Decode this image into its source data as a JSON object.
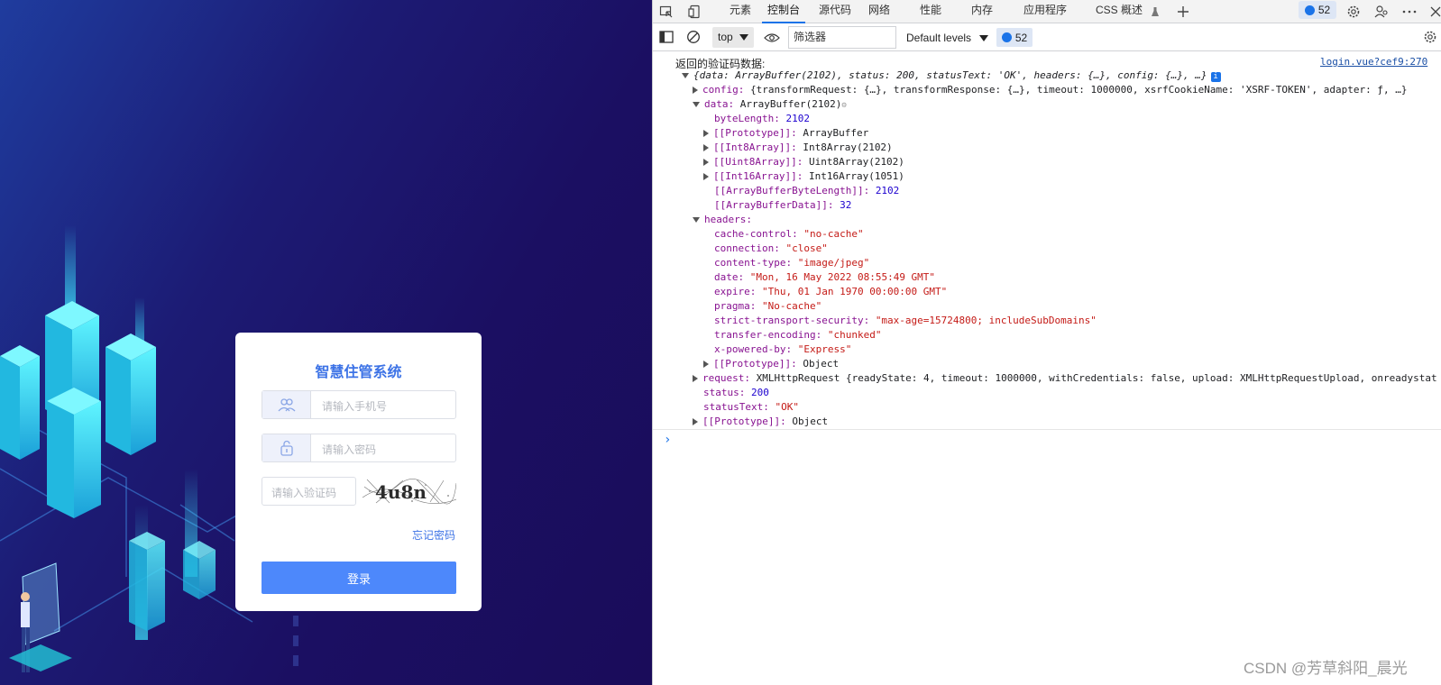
{
  "app": {
    "title": "智慧住管系统",
    "phone_placeholder": "请输入手机号",
    "password_placeholder": "请输入密码",
    "captcha_placeholder": "请输入验证码",
    "captcha_text": "4u8n",
    "forgot_label": "忘记密码",
    "login_label": "登录",
    "accent_color": "#4d88fb",
    "title_color": "#3d73e6"
  },
  "devtools": {
    "tabs": [
      "元素",
      "控制台",
      "源代码",
      "网络",
      "性能",
      "内存",
      "应用程序",
      "CSS 概述"
    ],
    "active_tab": "控制台",
    "message_count": "52",
    "context": "top",
    "filter_placeholder": "筛选器",
    "levels_label": "Default levels",
    "issues_count": "52",
    "log_label": "返回的验证码数据:",
    "source_link": "login.vue?cef9:270",
    "lines": {
      "root": "{data: ArrayBuffer(2102), status: 200, statusText: 'OK', headers: {…}, config: {…}, …}",
      "config_key": "config:",
      "config_val": "{transformRequest: {…}, transformResponse: {…}, timeout: 1000000, xsrfCookieName: 'XSRF-TOKEN', adapter: ƒ, …}",
      "data_key": "data:",
      "data_val": "ArrayBuffer(2102)",
      "byteLength_key": "byteLength:",
      "byteLength_val": "2102",
      "proto_ab_key": "[[Prototype]]:",
      "proto_ab_val": "ArrayBuffer",
      "int8_key": "[[Int8Array]]:",
      "int8_val": "Int8Array(2102)",
      "uint8_key": "[[Uint8Array]]:",
      "uint8_val": "Uint8Array(2102)",
      "int16_key": "[[Int16Array]]:",
      "int16_val": "Int16Array(1051)",
      "abbl_key": "[[ArrayBufferByteLength]]:",
      "abbl_val": "2102",
      "abd_key": "[[ArrayBufferData]]:",
      "abd_val": "32",
      "headers_key": "headers:",
      "cache_key": "cache-control:",
      "cache_val": "\"no-cache\"",
      "conn_key": "connection:",
      "conn_val": "\"close\"",
      "ctype_key": "content-type:",
      "ctype_val": "\"image/jpeg\"",
      "date_key": "date:",
      "date_val": "\"Mon, 16 May 2022 08:55:49 GMT\"",
      "expire_key": "expire:",
      "expire_val": "\"Thu, 01 Jan 1970 00:00:00 GMT\"",
      "pragma_key": "pragma:",
      "pragma_val": "\"No-cache\"",
      "sts_key": "strict-transport-security:",
      "sts_val": "\"max-age=15724800; includeSubDomains\"",
      "te_key": "transfer-encoding:",
      "te_val": "\"chunked\"",
      "xpb_key": "x-powered-by:",
      "xpb_val": "\"Express\"",
      "proto_obj_key": "[[Prototype]]:",
      "proto_obj_val": "Object",
      "request_key": "request:",
      "request_val": "XMLHttpRequest {readyState: 4, timeout: 1000000, withCredentials: false, upload: XMLHttpRequestUpload, onreadystat",
      "status_key": "status:",
      "status_val": "200",
      "statusText_key": "statusText:",
      "statusText_val": "\"OK\"",
      "proto_root_key": "[[Prototype]]:",
      "proto_root_val": "Object"
    }
  },
  "watermark": "CSDN @芳草斜阳_晨光"
}
